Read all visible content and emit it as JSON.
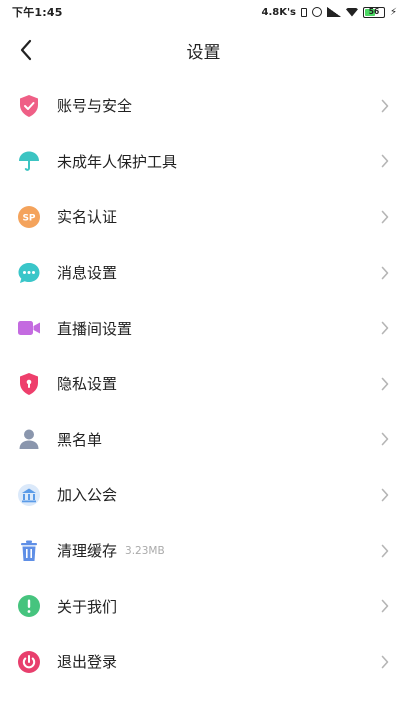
{
  "status_bar": {
    "time": "下午1:45",
    "net_speed": "4.8K's",
    "battery_level": "56",
    "battery_fraction": 0.56,
    "battery_color": "#4cd964"
  },
  "header": {
    "title": "设置",
    "back_icon": "chevron-left-icon"
  },
  "menu": {
    "items": [
      {
        "label": "账号与安全",
        "icon": "shield-check-icon",
        "color": "#ef5f86"
      },
      {
        "label": "未成年人保护工具",
        "icon": "umbrella-icon",
        "color": "#3cc4c2"
      },
      {
        "label": "实名认证",
        "icon": "id-badge-icon",
        "color": "#f4a35c"
      },
      {
        "label": "消息设置",
        "icon": "chat-bubble-icon",
        "color": "#3ac6c9"
      },
      {
        "label": "直播间设置",
        "icon": "video-camera-icon",
        "color": "#c46be0"
      },
      {
        "label": "隐私设置",
        "icon": "lock-shield-icon",
        "color": "#ee3f6c"
      },
      {
        "label": "黑名单",
        "icon": "user-block-icon",
        "color": "#8a96ad"
      },
      {
        "label": "加入公会",
        "icon": "guild-building-icon",
        "color": "#5a9be8"
      },
      {
        "label": "清理缓存",
        "icon": "trash-icon",
        "color": "#5f8fe6",
        "sub": "3.23MB"
      },
      {
        "label": "关于我们",
        "icon": "info-icon",
        "color": "#46c47e"
      },
      {
        "label": "退出登录",
        "icon": "power-icon",
        "color": "#e83f6d"
      }
    ]
  }
}
